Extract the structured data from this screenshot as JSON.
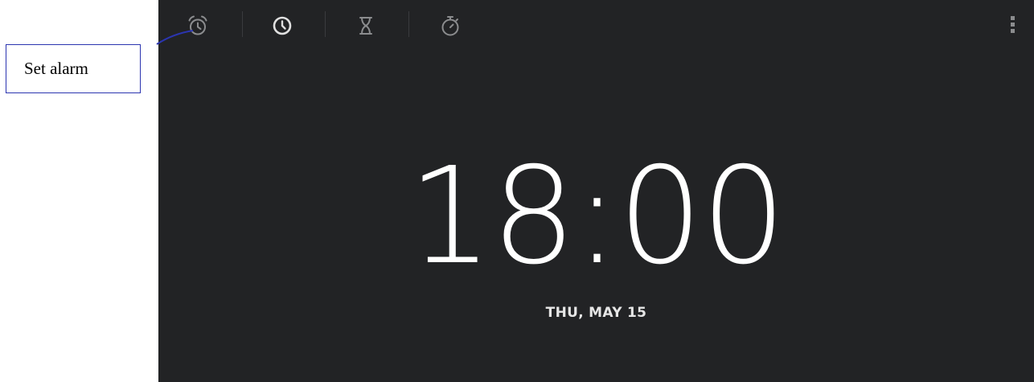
{
  "tabs": [
    {
      "icon": "alarm-icon"
    },
    {
      "icon": "clock-icon"
    },
    {
      "icon": "hourglass-timer-icon"
    },
    {
      "icon": "stopwatch-icon"
    }
  ],
  "overflow_menu": {
    "icon": "overflow-menu-icon"
  },
  "clock": {
    "time": "18:00",
    "date": "THU, MAY 15"
  },
  "callout": {
    "label": "Set alarm"
  },
  "colors": {
    "screen_bg": "#222325",
    "icon_inactive": "#8b8c8e",
    "icon_active": "#e0e0e0",
    "time_text": "#ffffff",
    "callout_border": "#2b35b0"
  }
}
